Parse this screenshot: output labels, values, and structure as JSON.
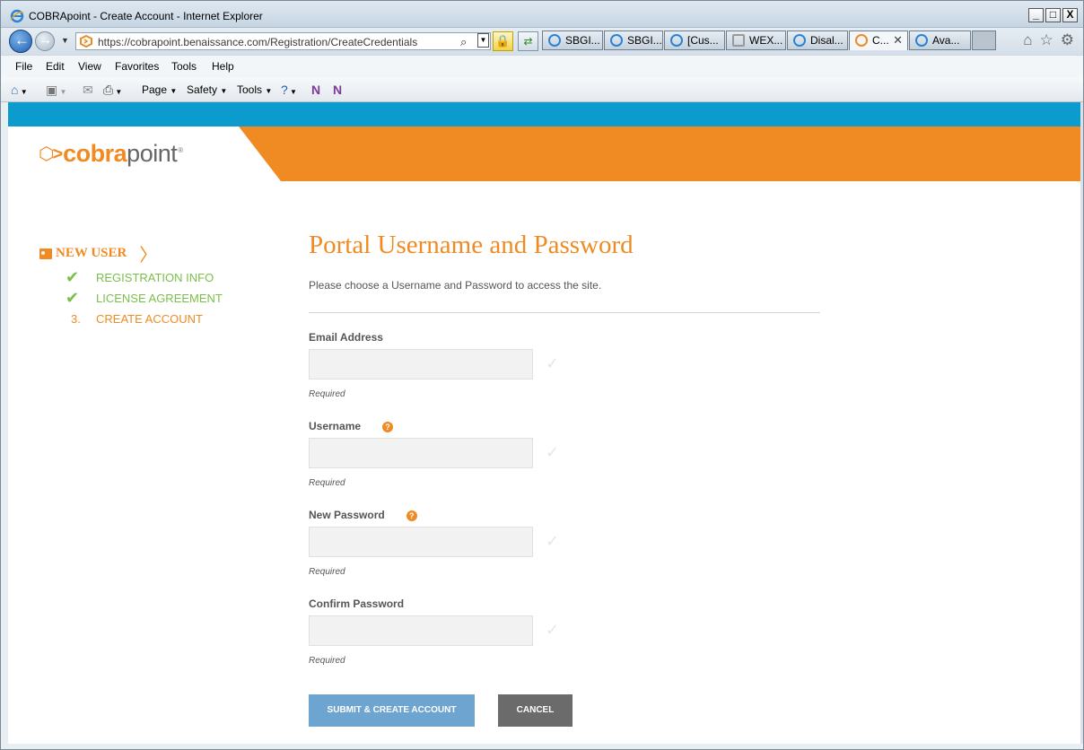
{
  "window": {
    "title": "COBRApoint - Create Account - Internet Explorer",
    "controls": [
      "_",
      "□",
      "X"
    ]
  },
  "navbar": {
    "url": "https://cobrapoint.benaissance.com/Registration/CreateCredentials",
    "tabs": [
      {
        "label": "SBGI...",
        "active": false
      },
      {
        "label": "SBGI...",
        "active": false
      },
      {
        "label": "[Cus...",
        "active": false
      },
      {
        "label": "WEX...",
        "active": false
      },
      {
        "label": "Disal...",
        "active": false
      },
      {
        "label": "C...",
        "active": true
      },
      {
        "label": "Ava...",
        "active": false
      }
    ]
  },
  "menubar": {
    "items": [
      "File",
      "Edit",
      "View",
      "Favorites",
      "Tools",
      "Help"
    ]
  },
  "cmdbar": {
    "page": "Page",
    "safety": "Safety",
    "tools": "Tools"
  },
  "header": {
    "logo_cobra": "cobra",
    "logo_point": "point",
    "logo_reg": "®"
  },
  "steps": {
    "heading": "NEW USER",
    "items": [
      {
        "label": "REGISTRATION INFO",
        "status": "done"
      },
      {
        "label": "LICENSE AGREEMENT",
        "status": "done"
      },
      {
        "num": "3.",
        "label": "CREATE ACCOUNT",
        "status": "current"
      }
    ]
  },
  "form": {
    "title": "Portal Username and Password",
    "intro": "Please choose a Username and Password to access the site.",
    "fields": [
      {
        "label": "Email Address",
        "required": "Required",
        "help": false
      },
      {
        "label": "Username",
        "required": "Required",
        "help": true
      },
      {
        "label": "New Password",
        "required": "Required",
        "help": true
      },
      {
        "label": "Confirm Password",
        "required": "Required",
        "help": false
      }
    ],
    "submit_label": "SUBMIT & CREATE ACCOUNT",
    "cancel_label": "CANCEL"
  },
  "colors": {
    "brand_orange": "#ef8b22",
    "brand_blue": "#0b9ccd",
    "success_green": "#7bbf4a",
    "submit_blue": "#6da4d0",
    "cancel_gray": "#6b6b6b"
  }
}
